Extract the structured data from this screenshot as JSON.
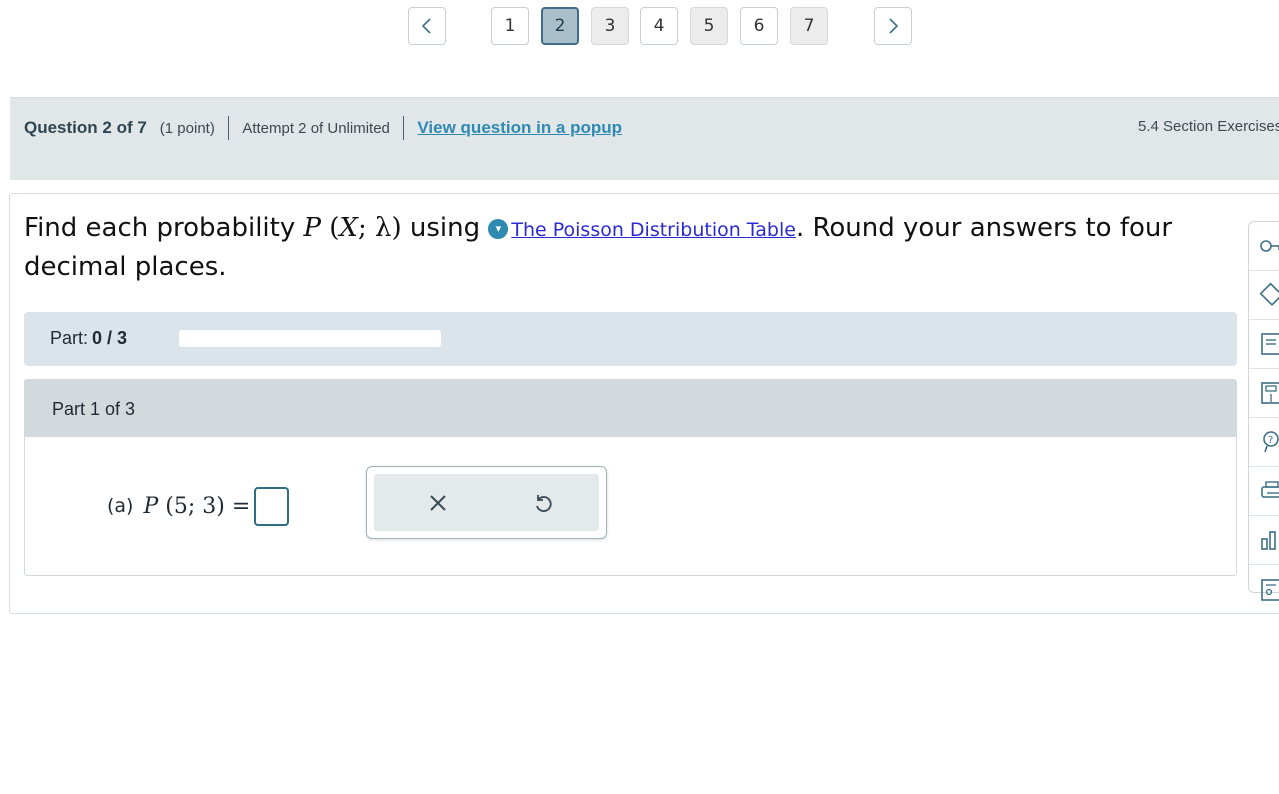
{
  "pager": {
    "pages": [
      "1",
      "2",
      "3",
      "4",
      "5",
      "6",
      "7"
    ],
    "current": "2"
  },
  "header": {
    "title": "Question 2 of 7",
    "points": "(1 point)",
    "attempt": "Attempt 2 of Unlimited",
    "popup_link": "View question in a popup",
    "section": "5.4 Section Exercises"
  },
  "question": {
    "text_before": "Find each probability",
    "math": "P(X; λ)",
    "text_using": "using",
    "table_link": "The Poisson Distribution Table",
    "text_after": ". Round your answers to four decimal places."
  },
  "progress": {
    "label": "Part:",
    "value": "0 / 3",
    "fraction": 0
  },
  "part": {
    "title": "Part 1 of 3",
    "answer_label": "(a)",
    "answer_expr": "P(5; 3) =",
    "answer_value": ""
  },
  "icons": {
    "prev": "chevron-left-icon",
    "next": "chevron-right-icon",
    "clear": "close-icon",
    "undo": "undo-icon",
    "info": "info-icon",
    "rail": [
      "key-icon",
      "eraser-icon",
      "notes-icon",
      "calculator-icon",
      "help-icon",
      "print-icon",
      "chart-icon",
      "settings-icon"
    ]
  },
  "colors": {
    "accent": "#3d6f86",
    "link": "#2f8ab1",
    "header_bg": "#e1e6e9"
  }
}
